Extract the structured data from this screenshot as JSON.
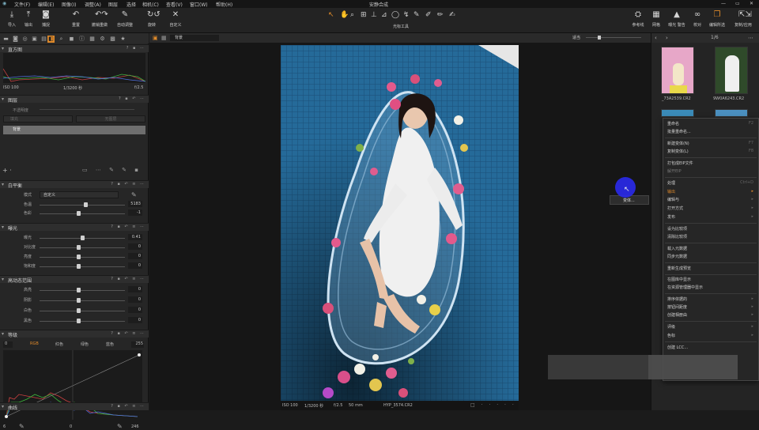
{
  "window": {
    "title": "安静合成"
  },
  "menu": [
    "文件(F)",
    "编辑(E)",
    "图像(I)",
    "调整(A)",
    "图层",
    "选择",
    "相机(C)",
    "查看(V)",
    "窗口(W)",
    "帮助(H)"
  ],
  "toolbar": {
    "left": [
      {
        "icon": "import-icon",
        "label": "导入"
      },
      {
        "icon": "export-icon",
        "label": "输出"
      },
      {
        "icon": "camera-icon",
        "label": "捕捉"
      },
      {
        "icon": "reset-icon",
        "label": "重置"
      },
      {
        "icon": "undo-icon",
        "label": "撤销重做"
      },
      {
        "icon": "auto-adjust-icon",
        "label": "自动调整"
      },
      {
        "icon": "rotate-icon",
        "label": "旋转"
      },
      {
        "icon": "customize-icon",
        "label": "自定义"
      }
    ],
    "center_label": "光标工具",
    "right": [
      {
        "icon": "reference-icon",
        "label": "参考线"
      },
      {
        "icon": "grid-icon",
        "label": "网格"
      },
      {
        "icon": "exposure-warning-icon",
        "label": "曝光 警告"
      },
      {
        "icon": "proof-icon",
        "label": "校对"
      },
      {
        "icon": "edit-selection-icon",
        "label": "编辑所选"
      },
      {
        "icon": "copy-apply-icon",
        "label": "复制/应用"
      }
    ]
  },
  "histogram": {
    "title": "直方图",
    "iso": "ISO 100",
    "shutter": "1/3200 秒",
    "aperture": "f/2.5"
  },
  "layers": {
    "title": "图层",
    "opacity_label": "不透明度",
    "layer_mode": "填充",
    "layer_btn": "无图层",
    "background_layer": "背景"
  },
  "white_balance": {
    "title": "白平衡",
    "mode_label": "模式",
    "mode_value": "自定义",
    "temp_label": "色温",
    "temp_value": "5183",
    "tint_label": "色彩",
    "tint_value": "-1"
  },
  "exposure": {
    "title": "曝光",
    "rows": [
      {
        "label": "曝光",
        "value": "0.41"
      },
      {
        "label": "对比度",
        "value": "0"
      },
      {
        "label": "亮度",
        "value": "0"
      },
      {
        "label": "饱和度",
        "value": "0"
      }
    ]
  },
  "hdr": {
    "title": "高动态范围",
    "rows": [
      {
        "label": "高亮",
        "value": "0"
      },
      {
        "label": "阴影",
        "value": "0"
      },
      {
        "label": "白色",
        "value": "0"
      },
      {
        "label": "黑色",
        "value": "0"
      }
    ]
  },
  "levels": {
    "title": "等级",
    "min": "0",
    "channels": [
      "RGB",
      "红色",
      "绿色",
      "蓝色"
    ],
    "max": "255",
    "out_min": "6",
    "mid": "0",
    "out_max": "246"
  },
  "curves": {
    "title": "曲线"
  },
  "viewer": {
    "layer_select": "背景",
    "fit_label": "适当",
    "counter": "1/6"
  },
  "status": {
    "iso": "ISO 100",
    "shutter": "1/3200 秒",
    "aperture": "f/2.5",
    "focal": "50 mm",
    "filename": "HYP_3574.CR2"
  },
  "thumbs": [
    {
      "name": "_73A2539.CR2"
    },
    {
      "name": "9W0A6243.CR2"
    }
  ],
  "context_menu": [
    {
      "label": "重命名",
      "shortcut": "F2"
    },
    {
      "label": "批量重命名..."
    },
    {
      "sep": true
    },
    {
      "label": "新建变体(N)",
      "shortcut": "F7"
    },
    {
      "label": "复制变体(L)",
      "shortcut": "F8"
    },
    {
      "sep": true
    },
    {
      "label": "打包成EIP文件"
    },
    {
      "label": "解开EIP",
      "dis": true
    },
    {
      "sep": true
    },
    {
      "label": "处理",
      "shortcut": "Ctrl+D"
    },
    {
      "label": "输出",
      "hl": true,
      "arrow": true
    },
    {
      "label": "编辑与",
      "arrow": true
    },
    {
      "label": "打开方式",
      "arrow": true
    },
    {
      "label": "发布",
      "arrow": true
    },
    {
      "sep": true
    },
    {
      "label": "设为比较项"
    },
    {
      "label": "清除比较项"
    },
    {
      "sep": true
    },
    {
      "label": "载入元数据"
    },
    {
      "label": "同步元数据"
    },
    {
      "sep": true
    },
    {
      "label": "重新生成预览"
    },
    {
      "sep": true
    },
    {
      "label": "在图库中显示"
    },
    {
      "label": "在资源管理器中显示"
    },
    {
      "sep": true
    },
    {
      "label": "排序依据的",
      "arrow": true
    },
    {
      "label": "按钮间距度",
      "arrow": true
    },
    {
      "label": "创建相册由",
      "arrow": true
    },
    {
      "sep": true
    },
    {
      "label": "评级",
      "arrow": true
    },
    {
      "label": "色标",
      "arrow": true
    },
    {
      "sep": true
    },
    {
      "label": "创建 LCC..."
    }
  ],
  "submenu": {
    "label": "变体..."
  }
}
